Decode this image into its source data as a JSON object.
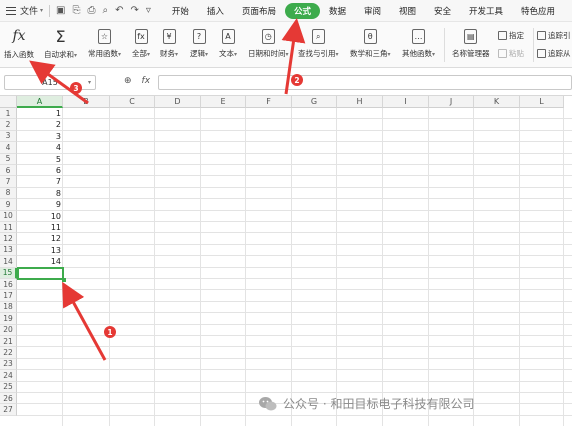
{
  "menu": {
    "file_label": "文件",
    "tabs": [
      {
        "label": "开始",
        "active": false
      },
      {
        "label": "插入",
        "active": false
      },
      {
        "label": "页面布局",
        "active": false
      },
      {
        "label": "公式",
        "active": true
      },
      {
        "label": "数据",
        "active": false
      },
      {
        "label": "审阅",
        "active": false
      },
      {
        "label": "视图",
        "active": false
      },
      {
        "label": "安全",
        "active": false
      },
      {
        "label": "开发工具",
        "active": false
      },
      {
        "label": "特色应用",
        "active": false
      }
    ],
    "accent_color": "#3dab4c"
  },
  "ribbon": {
    "insert_function": {
      "icon": "fx",
      "label": "插入函数"
    },
    "autosum": {
      "icon": "Σ",
      "label": "自动求和"
    },
    "common_func": {
      "label": "常用函数"
    },
    "all_func": {
      "label": "全部"
    },
    "finance": {
      "label": "财务"
    },
    "logic": {
      "label": "逻辑"
    },
    "text": {
      "label": "文本"
    },
    "datetime": {
      "label": "日期和时间"
    },
    "lookup": {
      "label": "查找与引用"
    },
    "math": {
      "label": "数学和三角"
    },
    "other": {
      "label": "其他函数"
    },
    "name_mgr": {
      "label": "名称管理器"
    },
    "specify": {
      "label": "指定"
    },
    "paste": {
      "label": "粘贴"
    },
    "trace_prec": {
      "label": "追踪引"
    },
    "trace_dep": {
      "label": "追踪从"
    }
  },
  "formula_bar": {
    "name_box": "A15",
    "zoom_icon": "⊕",
    "fx_label": "fx",
    "content": ""
  },
  "grid": {
    "columns": [
      "A",
      "B",
      "C",
      "D",
      "E",
      "F",
      "G",
      "H",
      "I",
      "J",
      "K",
      "L"
    ],
    "selected_column": "A",
    "rows": [
      "1",
      "2",
      "3",
      "4",
      "5",
      "6",
      "7",
      "8",
      "9",
      "10",
      "11",
      "12",
      "13",
      "14",
      "15",
      "16",
      "17",
      "18",
      "19",
      "20",
      "21",
      "22",
      "23",
      "24",
      "25",
      "26",
      "27"
    ],
    "selected_row": "15",
    "column_a_values": [
      "1",
      "2",
      "3",
      "4",
      "5",
      "6",
      "7",
      "8",
      "9",
      "10",
      "11",
      "12",
      "13",
      "14"
    ]
  },
  "annotations": [
    {
      "number": "1",
      "color": "#e53935"
    },
    {
      "number": "2",
      "color": "#e53935"
    },
    {
      "number": "3",
      "color": "#e53935"
    }
  ],
  "watermark": {
    "text": "公众号 · 和田目标电子科技有限公司",
    "icon": "wechat-icon"
  }
}
